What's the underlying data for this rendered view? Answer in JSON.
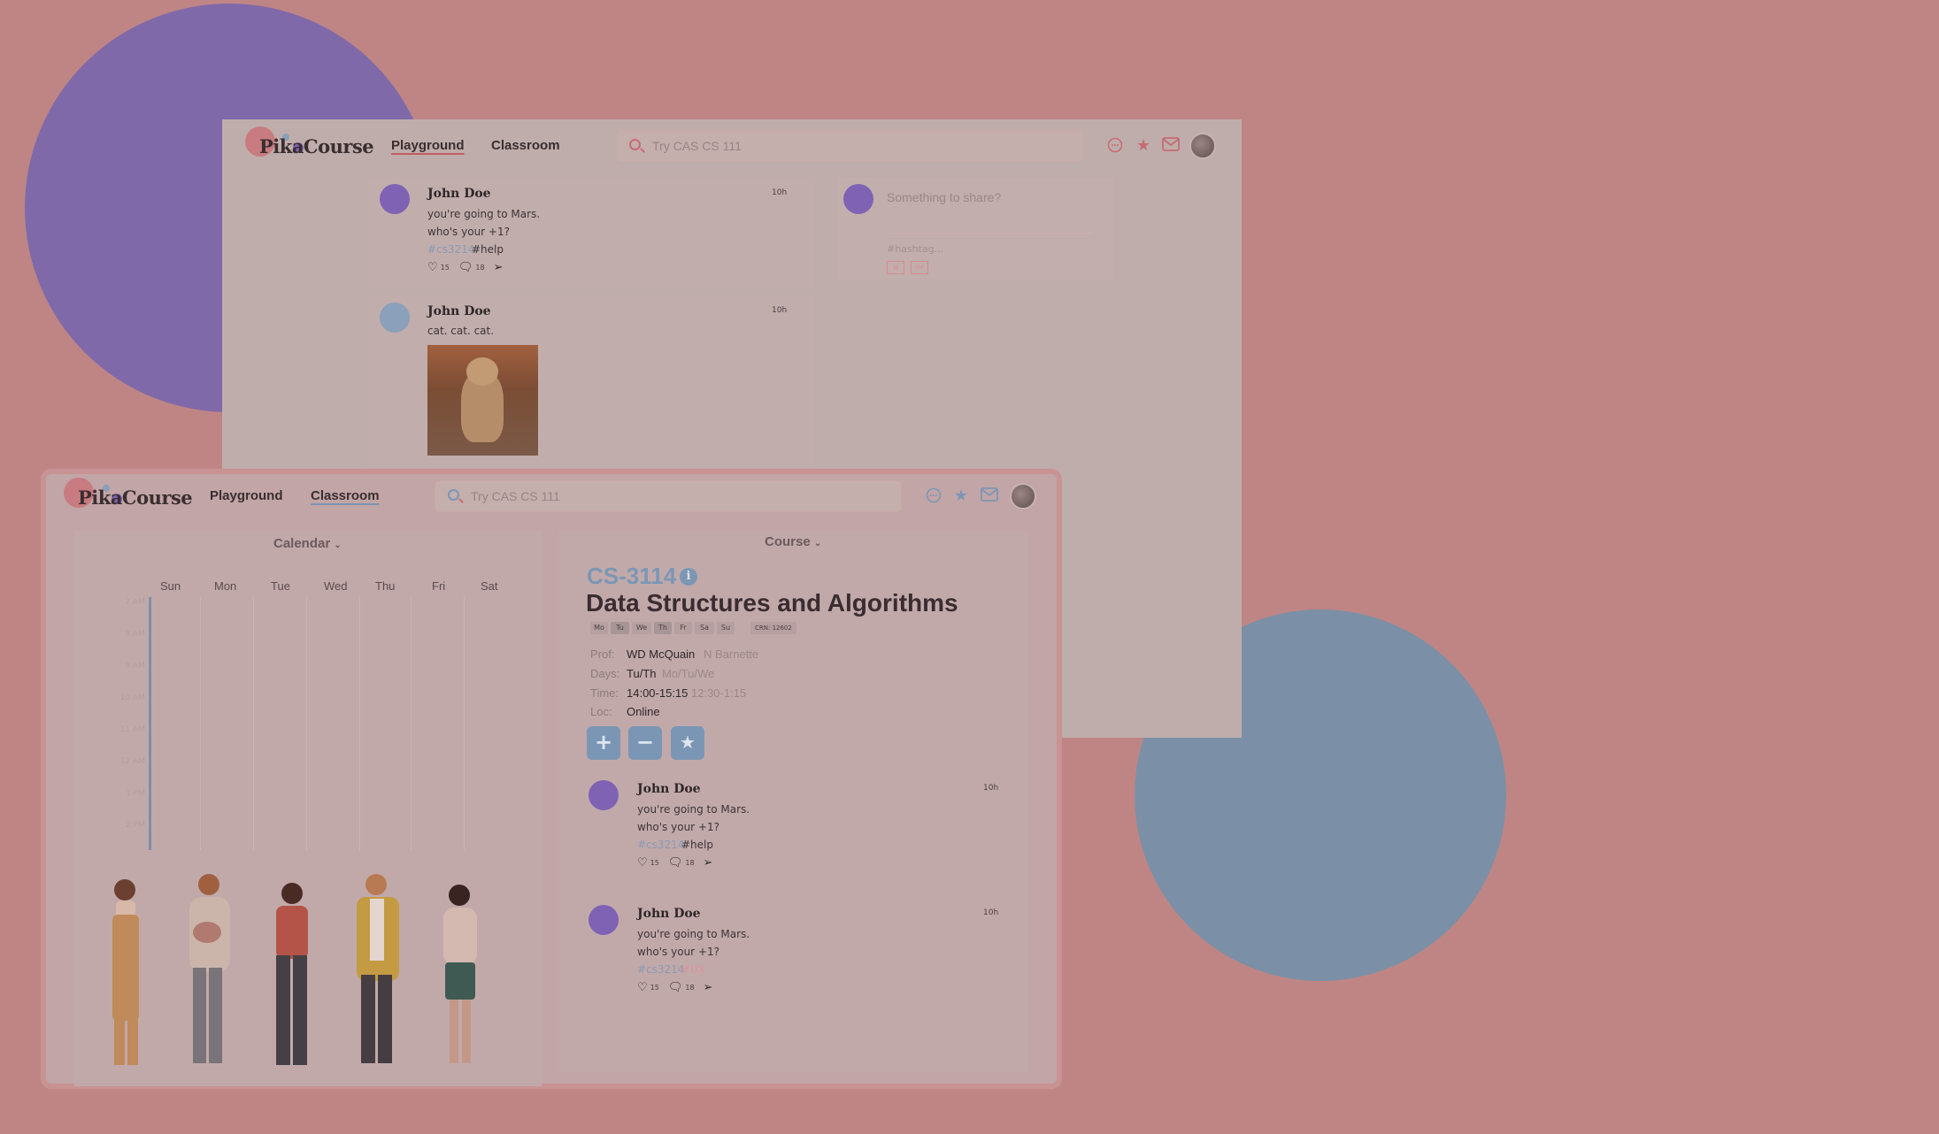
{
  "back_window": {
    "logo": "PikaCourse",
    "nav": {
      "playground": "Playground",
      "classroom": "Classroom"
    },
    "search_placeholder": "Try CAS CS 111",
    "posts": [
      {
        "author": "John Doe",
        "time": "10h",
        "lines": [
          "you're going to Mars.",
          "who's your +1?"
        ],
        "tags": [
          "#cs3214",
          "#help"
        ],
        "likes": "15",
        "comments": "18"
      },
      {
        "author": "John Doe",
        "time": "10h",
        "lines": [
          "cat. cat. cat."
        ]
      }
    ],
    "share": {
      "prompt": "Something to share?",
      "hashtag_placeholder": "#hashtag...",
      "gif_label": "GIF"
    }
  },
  "front_window": {
    "logo": "PikaCourse",
    "nav": {
      "playground": "Playground",
      "classroom": "Classroom"
    },
    "search_placeholder": "Try CAS CS 111",
    "calendar": {
      "title": "Calendar",
      "days": [
        "Sun",
        "Mon",
        "Tue",
        "Wed",
        "Thu",
        "Fri",
        "Sat"
      ],
      "hours": [
        "7 AM",
        "8 AM",
        "9 AM",
        "10 AM",
        "11 AM",
        "12 AM",
        "1 PM",
        "2 PM"
      ]
    },
    "course": {
      "panel_title": "Course",
      "code": "CS-3114",
      "title": "Data Structures and Algorithms",
      "day_chips": [
        "Mo",
        "Tu",
        "We",
        "Th",
        "Fr",
        "Sa",
        "Su"
      ],
      "crn": "CRN: 12602",
      "prof_label": "Prof:",
      "prof": "WD McQuain",
      "prof_alt": "N Barnette",
      "days_label": "Days:",
      "days": "Tu/Th",
      "days_alt": "Mo/Tu/We",
      "time_label": "Time:",
      "time": "14:00-15:15",
      "time_alt": "12:30-1:15",
      "loc_label": "Loc:",
      "loc": "Online"
    },
    "posts": [
      {
        "author": "John Doe",
        "time": "10h",
        "lines": [
          "you're going to Mars.",
          "who's your +1?"
        ],
        "tags": [
          "#cs3214",
          "#help"
        ],
        "likes": "15",
        "comments": "18"
      },
      {
        "author": "John Doe",
        "time": "10h",
        "lines": [
          "you're going to Mars.",
          "who's your +1?"
        ],
        "tags": [
          "#cs3214",
          "#UX"
        ],
        "likes": "15",
        "comments": "18"
      }
    ]
  },
  "colors": {
    "background": "#bf8585",
    "accent_purple": "#8069a8",
    "accent_blue": "#7b96b5",
    "accent_red": "#c76b74"
  },
  "icons": [
    "search-icon",
    "chat-icon",
    "star-icon",
    "mail-icon",
    "heart-icon",
    "comment-icon",
    "send-icon",
    "image-icon",
    "gif-icon",
    "plus-icon",
    "minus-icon",
    "info-icon",
    "chevron-down-icon"
  ]
}
